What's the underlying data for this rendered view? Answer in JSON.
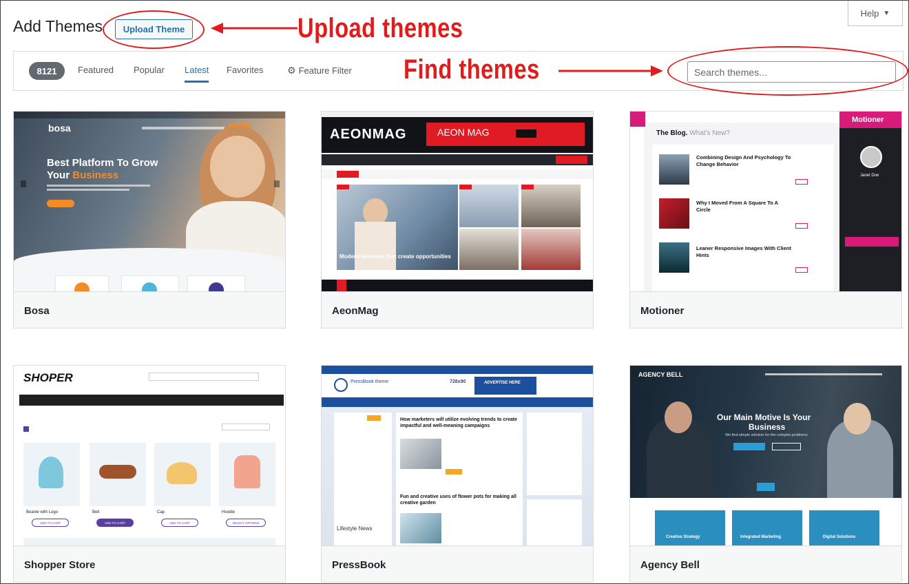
{
  "header": {
    "title": "Add Themes",
    "upload_label": "Upload Theme",
    "help_label": "Help"
  },
  "annotations": {
    "upload": "Upload themes",
    "find": "Find themes",
    "color": "#e11c1c"
  },
  "filters": {
    "count": "8121",
    "items": [
      "Featured",
      "Popular",
      "Latest",
      "Favorites"
    ],
    "active": "Latest",
    "feature_filter": "Feature Filter",
    "search_placeholder": "Search themes..."
  },
  "colors": {
    "accent": "#2271b1",
    "badge": "#646970",
    "card_footer": "#f6f7f7"
  },
  "themes": [
    {
      "name": "Bosa",
      "preview": {
        "logo": "bosa",
        "headline_1": "Best Platform To Grow",
        "headline_2a": "Your ",
        "headline_2b": "Business"
      }
    },
    {
      "name": "AeonMag",
      "preview": {
        "logo": "AEONMAG",
        "ad_text": "AEON MAG",
        "feature_caption": "Modern business that create opportunities"
      }
    },
    {
      "name": "Motioner",
      "preview": {
        "blog_title": "The Blog.",
        "blog_sub": "What's New?",
        "sidebar_title": "Motioner",
        "author": "Janet Doe",
        "posts": [
          "Combining Design And Psychology To Change Behavior",
          "Why I Moved From A Square To A Circle",
          "Leaner Responsive Images With Client Hints"
        ]
      }
    },
    {
      "name": "Shopper Store",
      "preview": {
        "logo": "SHOPER",
        "products": [
          "Beanie with Logo",
          "Belt",
          "Cap",
          "Hoodie"
        ],
        "cart_label": "ADD TO CART",
        "options_label": "SELECT OPTIONS"
      }
    },
    {
      "name": "PressBook",
      "preview": {
        "logo": "PressBook theme",
        "ad_label": "ADVERTISE HERE",
        "size_label": "728x90",
        "post_1": "How marketers will utilize evolving trends to create impactful and well-meaning campaigns",
        "post_2": "Fun and creative uses of flower pots for making all creative garden",
        "sidebar_news": "Lifestyle News"
      }
    },
    {
      "name": "Agency Bell",
      "preview": {
        "logo": "AGENCY BELL",
        "headline_1": "Our Main Motive Is Your",
        "headline_2": "Business",
        "tagline": "We find simple solution for the complex problems",
        "services": [
          "Creative Strategy",
          "Integrated Marketing",
          "Digital Solutions"
        ]
      }
    }
  ]
}
